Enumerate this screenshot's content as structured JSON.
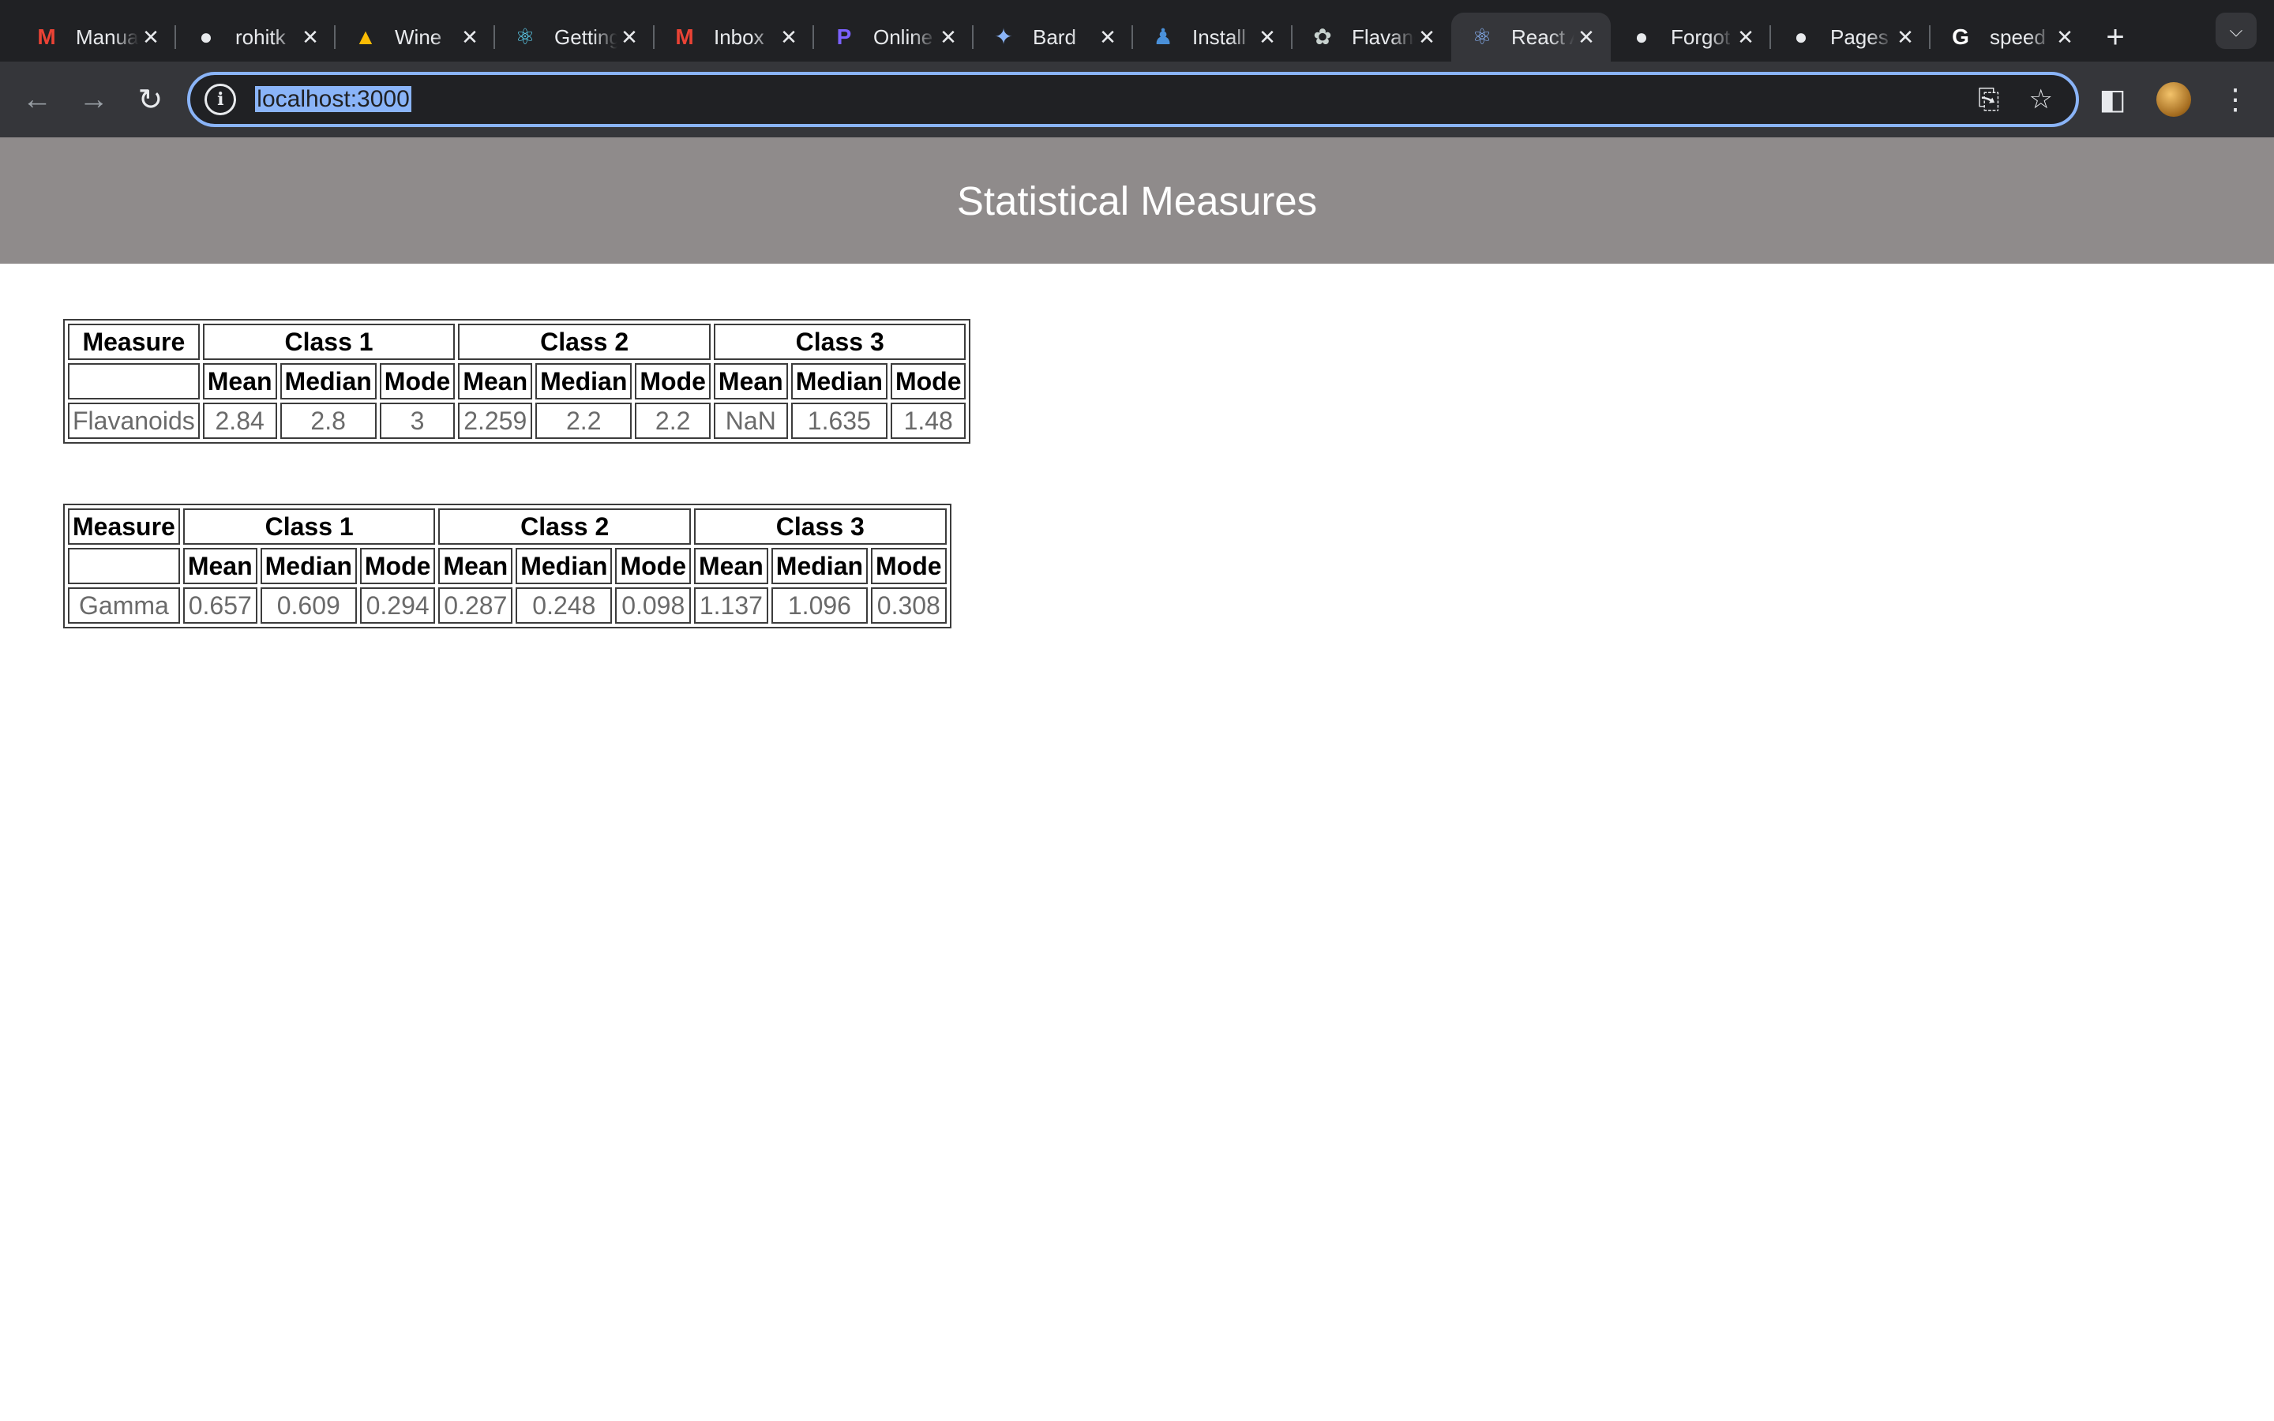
{
  "browser": {
    "tabs": [
      {
        "title": "Manual",
        "icon": "gmail-icon",
        "glyph": "M",
        "color": "#ea4335"
      },
      {
        "title": "rohitk",
        "icon": "github-icon",
        "glyph": "●",
        "color": "#e8eaed"
      },
      {
        "title": "Wine",
        "icon": "google-drive-icon",
        "glyph": "▲",
        "color": "#fbbc04"
      },
      {
        "title": "Getting",
        "icon": "react-icon",
        "glyph": "⚛",
        "color": "#61dafb"
      },
      {
        "title": "Inbox",
        "icon": "gmail-icon",
        "glyph": "M",
        "color": "#ea4335"
      },
      {
        "title": "Online",
        "icon": "payment-icon",
        "glyph": "P",
        "color": "#7b61ff"
      },
      {
        "title": "Bard",
        "icon": "bard-sparkle-icon",
        "glyph": "✦",
        "color": "#8ab4f8"
      },
      {
        "title": "Install",
        "icon": "python-icon",
        "glyph": "♟",
        "color": "#4a90d9"
      },
      {
        "title": "Flavanoids",
        "icon": "chatgpt-icon",
        "glyph": "✿",
        "color": "#c8d2cf"
      },
      {
        "title": "React App",
        "icon": "react-icon",
        "glyph": "⚛",
        "color": "#8ab4f8"
      },
      {
        "title": "Forgot",
        "icon": "github-icon",
        "glyph": "●",
        "color": "#e8eaed"
      },
      {
        "title": "Pages",
        "icon": "github-icon",
        "glyph": "●",
        "color": "#e8eaed"
      },
      {
        "title": "speed",
        "icon": "google-icon",
        "glyph": "G",
        "color": "#ffffff"
      }
    ],
    "active_tab": 9,
    "close_glyph": "✕",
    "new_tab_glyph": "+",
    "url": "localhost:3000"
  },
  "page": {
    "title": "Statistical Measures"
  },
  "tables": [
    {
      "header": [
        "Measure",
        "Class 1",
        "Class 2",
        "Class 3"
      ],
      "subheader": [
        "",
        "Mean",
        "Median",
        "Mode",
        "Mean",
        "Median",
        "Mode",
        "Mean",
        "Median",
        "Mode"
      ],
      "row": [
        "Flavanoids",
        "2.84",
        "2.8",
        "3",
        "2.259",
        "2.2",
        "2.2",
        "NaN",
        "1.635",
        "1.48"
      ]
    },
    {
      "header": [
        "Measure",
        "Class 1",
        "Class 2",
        "Class 3"
      ],
      "subheader": [
        "",
        "Mean",
        "Median",
        "Mode",
        "Mean",
        "Median",
        "Mode",
        "Mean",
        "Median",
        "Mode"
      ],
      "row": [
        "Gamma",
        "0.657",
        "0.609",
        "0.294",
        "0.287",
        "0.248",
        "0.098",
        "1.137",
        "1.096",
        "0.308"
      ]
    }
  ]
}
